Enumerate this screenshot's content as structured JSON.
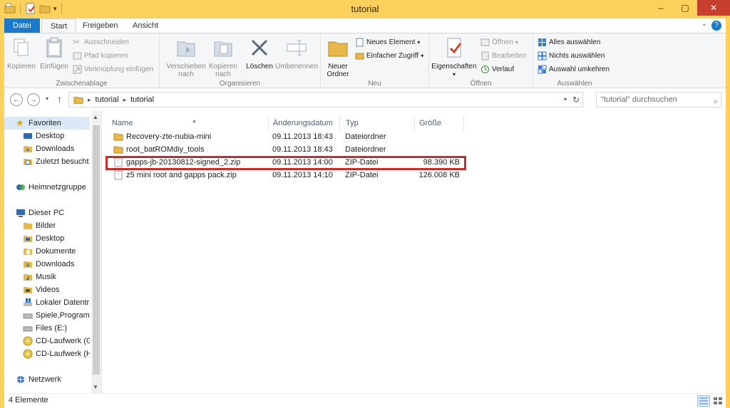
{
  "window": {
    "title": "tutorial",
    "min": "–",
    "max": "▢",
    "close": "✕"
  },
  "tabs": {
    "file": "Datei",
    "items": [
      "Start",
      "Freigeben",
      "Ansicht"
    ],
    "active": "Start",
    "help": "?"
  },
  "ribbon": {
    "clipboard": {
      "label": "Zwischenablage",
      "copy": "Kopieren",
      "paste": "Einfügen",
      "cut": "Ausschneiden",
      "copy_path": "Pfad kopieren",
      "paste_shortcut": "Verknüpfung einfügen"
    },
    "organize": {
      "label": "Organisieren",
      "move_to": "Verschieben nach",
      "copy_to": "Kopieren nach",
      "delete": "Löschen",
      "rename": "Umbenennen"
    },
    "new": {
      "label": "Neu",
      "new_folder": "Neuer Ordner",
      "new_item": "Neues Element",
      "easy_access": "Einfacher Zugriff"
    },
    "open": {
      "label": "Öffnen",
      "properties": "Eigenschaften",
      "open": "Öffnen",
      "edit": "Bearbeiten",
      "history": "Verlauf"
    },
    "select": {
      "label": "Auswählen",
      "select_all": "Alles auswählen",
      "select_none": "Nichts auswählen",
      "invert": "Auswahl umkehren"
    }
  },
  "address": {
    "crumbs": [
      "tutorial",
      "tutorial"
    ],
    "search_placeholder": "\"tutorial\" durchsuchen"
  },
  "navpane": {
    "favorites": "Favoriten",
    "fav_items": [
      "Desktop",
      "Downloads",
      "Zuletzt besucht"
    ],
    "homegroup": "Heimnetzgruppe",
    "thispc": "Dieser PC",
    "pc_items": [
      "Bilder",
      "Desktop",
      "Dokumente",
      "Downloads",
      "Musik",
      "Videos",
      "Lokaler Datenträg",
      "Spiele,Programm",
      "Files (E:)",
      "CD-Laufwerk (G:)",
      "CD-Laufwerk (H:"
    ],
    "network": "Netzwerk"
  },
  "columns": {
    "name": "Name",
    "date": "Änderungsdatum",
    "type": "Typ",
    "size": "Größe"
  },
  "files": [
    {
      "name": "Recovery-zte-nubia-mini",
      "date": "09.11.2013 18:43",
      "type": "Dateiordner",
      "size": "",
      "kind": "folder"
    },
    {
      "name": "root_batROMdiy_tools",
      "date": "09.11.2013 18:43",
      "type": "Dateiordner",
      "size": "",
      "kind": "folder"
    },
    {
      "name": "gapps-jb-20130812-signed_2.zip",
      "date": "09.11.2013 14:00",
      "type": "ZIP-Datei",
      "size": "98.390 KB",
      "kind": "zip"
    },
    {
      "name": "z5 mini root and gapps pack.zip",
      "date": "09.11.2013 14:10",
      "type": "ZIP-Datei",
      "size": "126.008 KB",
      "kind": "zip"
    }
  ],
  "status": {
    "count": "4 Elemente"
  },
  "colors": {
    "title_bar": "#fbd15b",
    "file_tab": "#1979ca",
    "highlight": "#c92b2b",
    "folder": "#e8b84a"
  }
}
